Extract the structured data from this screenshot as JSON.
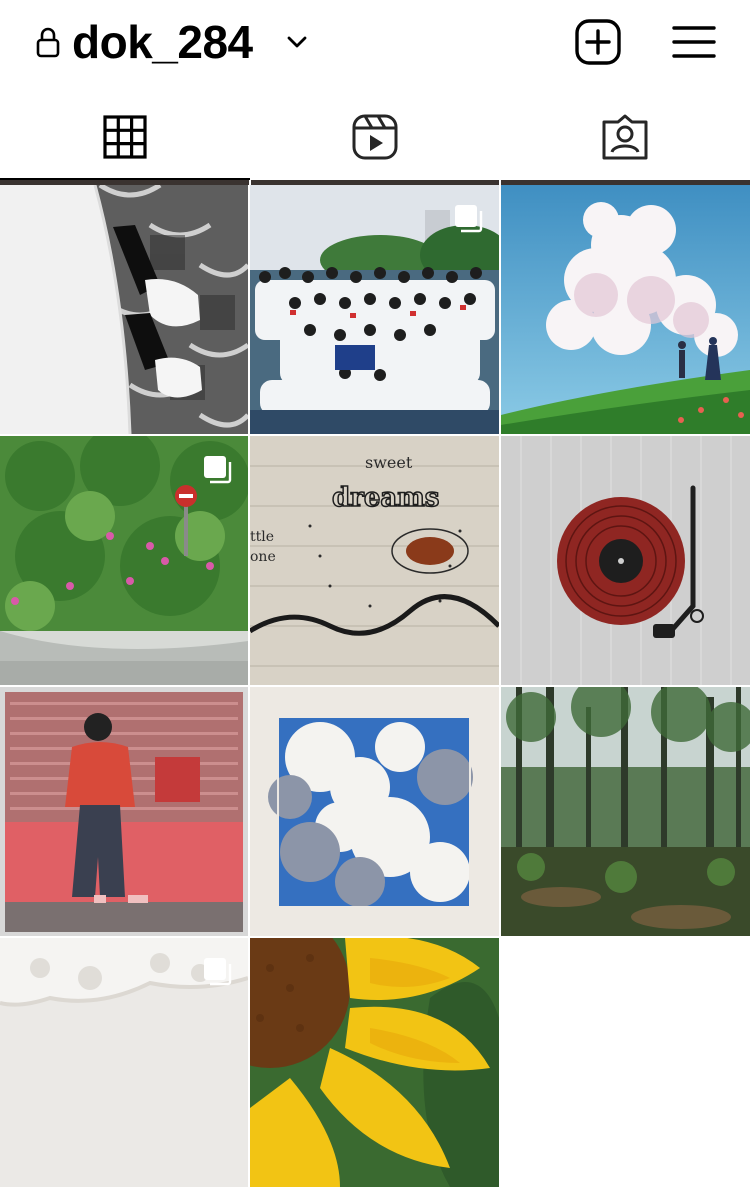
{
  "header": {
    "username": "dok_284",
    "icons": [
      "lock-icon",
      "chevron-down-icon",
      "plus-square-icon",
      "hamburger-menu-icon"
    ]
  },
  "tabs": [
    {
      "name": "posts",
      "icon": "grid-icon",
      "active": true
    },
    {
      "name": "reels",
      "icon": "reels-icon",
      "active": false
    },
    {
      "name": "tagged",
      "icon": "tagged-icon",
      "active": false
    }
  ],
  "posts": [
    {
      "subject": "white shirt and sneakers on tiles",
      "multiple": false
    },
    {
      "subject": "group photo of students",
      "multiple": true
    },
    {
      "subject": "anime sky with clouds",
      "multiple": false
    },
    {
      "subject": "flowering bushes and no-entry sign",
      "multiple": true
    },
    {
      "subject": "sweet dreams drawing",
      "multiple": false,
      "text": "sweet dreams"
    },
    {
      "subject": "vinyl record player illustration",
      "multiple": false
    },
    {
      "subject": "person against red wall",
      "multiple": false
    },
    {
      "subject": "clouds in blue sky print",
      "multiple": false
    },
    {
      "subject": "forest trees",
      "multiple": false
    },
    {
      "subject": "white sand beach",
      "multiple": true
    },
    {
      "subject": "sunflower petals",
      "multiple": false
    }
  ],
  "colors": {
    "background": "#ffffff",
    "text": "#000000",
    "icon": "#000000",
    "inactive_icon": "#262626"
  }
}
